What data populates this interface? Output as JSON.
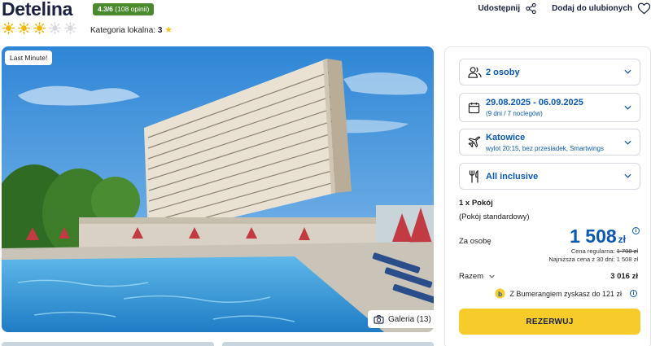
{
  "hotel": {
    "name": "Detelina",
    "rating_score": "4.3/6",
    "rating_count": "(108 opinii)",
    "sun_rating": 3,
    "sun_max": 5,
    "local_category_label": "Kategoria lokalna:",
    "local_category_value": "3"
  },
  "actions": {
    "share_label": "Udostępnij",
    "favorite_label": "Dodaj do ulubionych"
  },
  "gallery": {
    "badge": "Last Minute!",
    "button_label": "Galeria (13)"
  },
  "booking": {
    "travelers": "2 osoby",
    "dates_main": "29.08.2025 - 06.09.2025",
    "dates_sub": "(9 dni / 7 noclegów)",
    "departure_city": "Katowice",
    "departure_details": "wylot 20:15, bez przesiadek, Smartwings",
    "board": "All inclusive",
    "room_count": "1 x Pokój",
    "room_type": "(Pokój standardowy)",
    "per_person_label": "Za osobę",
    "price": "1 508",
    "currency": "zł",
    "regular_price_label": "Cena regularna:",
    "regular_price": "1 708 zł",
    "lowest_30_days": "Najniższa cena z 30 dni: 1 508 zł",
    "total_label": "Razem",
    "total_value": "3 016 zł",
    "bumerang_text": "Z Bumerangiem zyskasz do 121 zł",
    "reserve_label": "REZERWUJ"
  },
  "colors": {
    "brand_blue": "#0b58b3",
    "rating_green": "#4a8a2c",
    "reserve_yellow": "#f7cc2a",
    "sun_yellow": "#f5b400"
  }
}
